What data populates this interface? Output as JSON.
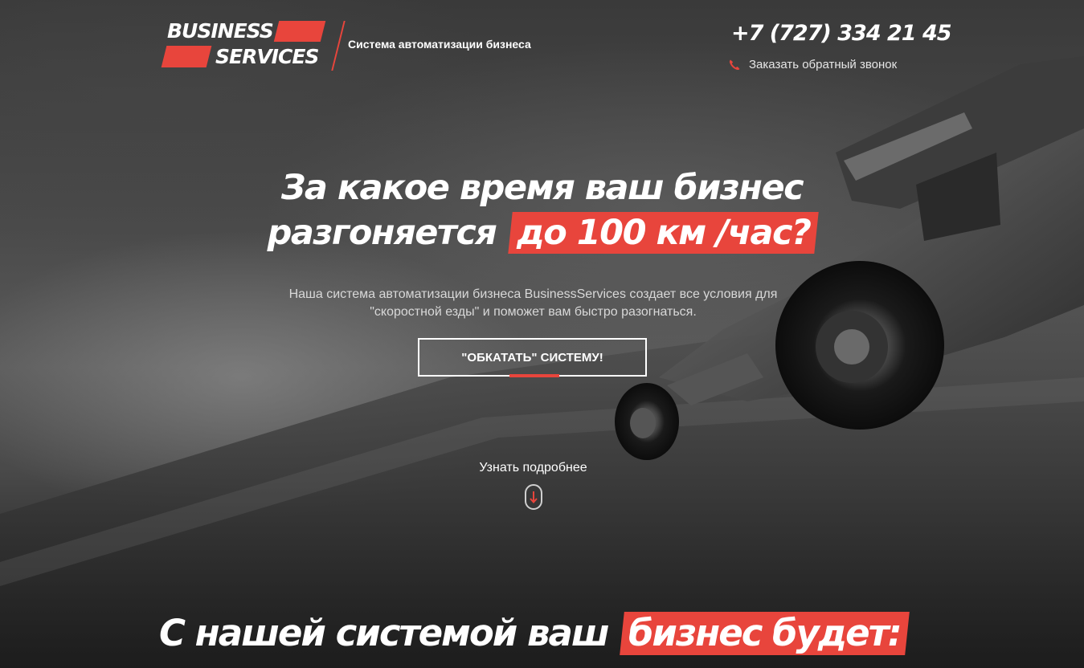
{
  "header": {
    "logo_line1": "BUSINESS",
    "logo_line2": "SERVICES",
    "tagline": "Система автоматизации бизнеса",
    "phone": "+7 (727) 334 21 45",
    "callback_label": "Заказать обратный звонок",
    "callback_icon": "phone-icon"
  },
  "hero": {
    "headline_line1": "За какое время ваш бизнес",
    "headline_line2_plain": "разгоняется",
    "headline_line2_highlight": "до 100 км /час?",
    "lead_line1": "Наша система автоматизации бизнеса BusinessServices создает все условия для",
    "lead_line2": "\"скоростной езды\" и поможет вам быстро разогнаться.",
    "cta_label": "\"ОБКАТАТЬ\" СИСТЕМУ!",
    "more_label": "Узнать подробнее",
    "more_icon": "arrow-down-icon"
  },
  "section2": {
    "heading_plain": "С нашей системой ваш",
    "heading_highlight": "бизнес будет:"
  },
  "colors": {
    "accent": "#e8453c",
    "text": "#ffffff"
  }
}
